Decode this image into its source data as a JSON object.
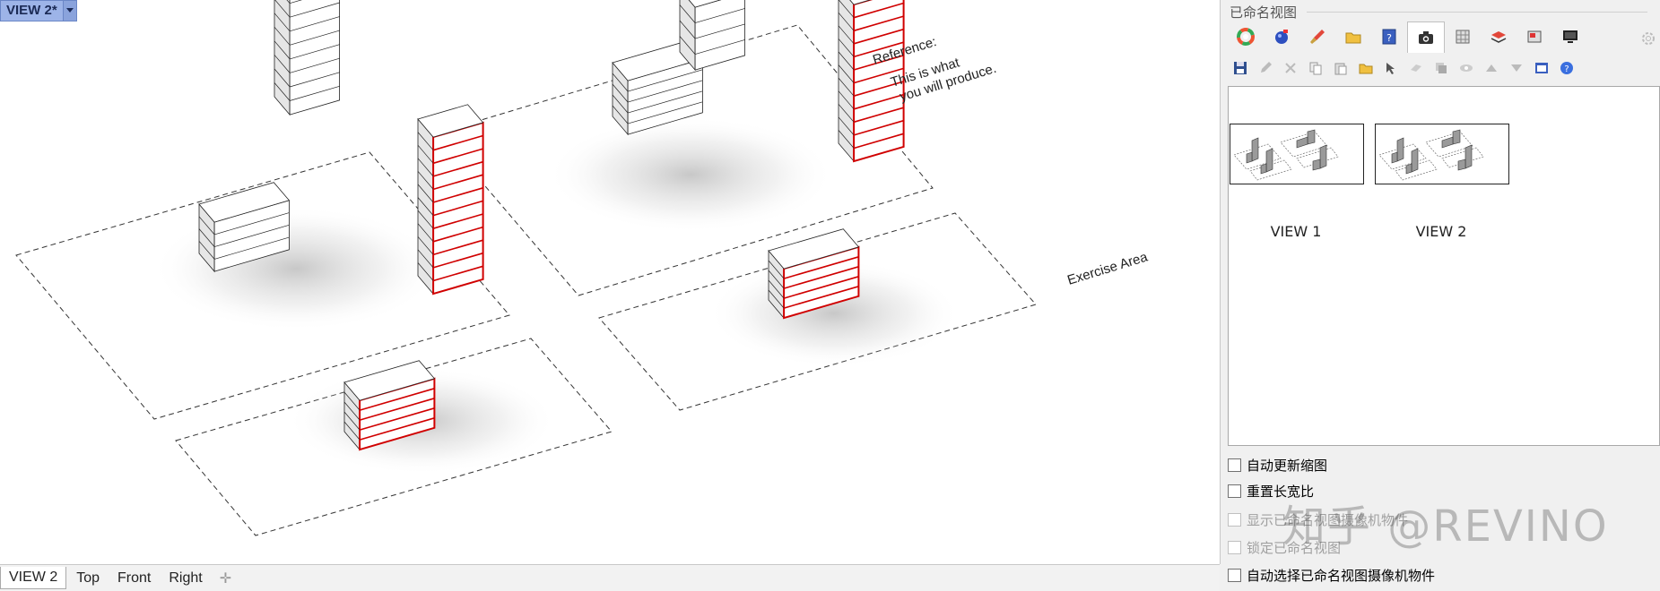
{
  "viewport": {
    "title": "VIEW 2*",
    "annotations": {
      "reference_line1": "Reference:",
      "reference_line2": "This is what",
      "reference_line3": "you will produce.",
      "exercise": "Exercise Area"
    }
  },
  "view_tabs": [
    "VIEW 2",
    "Top",
    "Front",
    "Right"
  ],
  "active_tab": "VIEW 2",
  "panel": {
    "title": "已命名视图",
    "panel_icons": [
      "color-wheel-icon",
      "material-ball-icon",
      "paint-brush-icon",
      "folder-icon",
      "help-book-icon",
      "camera-icon",
      "layers-grid-icon",
      "render-layer-icon",
      "display-mode-icon",
      "monitor-icon"
    ],
    "active_icon": "camera-icon",
    "toolbar_icons": [
      "save-icon",
      "edit-icon",
      "delete-icon",
      "copy-icon",
      "paste-icon",
      "open-folder-icon",
      "pick-icon",
      "link-icon",
      "duplicate-icon",
      "eye-icon",
      "move-up-icon",
      "move-down-icon",
      "window-icon",
      "help-icon"
    ],
    "thumbnails": [
      {
        "label": "VIEW 1"
      },
      {
        "label": "VIEW 2"
      }
    ],
    "options": [
      {
        "label": "自动更新缩图",
        "checked": false,
        "disabled": false
      },
      {
        "label": "重置长宽比",
        "checked": false,
        "disabled": false
      },
      {
        "label": "显示已命名视图摄像机物件",
        "checked": false,
        "disabled": true
      },
      {
        "label": "锁定已命名视图",
        "checked": false,
        "disabled": true
      },
      {
        "label": "自动选择已命名视图摄像机物件",
        "checked": false,
        "disabled": false
      }
    ]
  },
  "watermark": "知乎 @REVINO",
  "colors": {
    "highlight_red": "#d00000",
    "tag_blue": "#9db4e8"
  }
}
